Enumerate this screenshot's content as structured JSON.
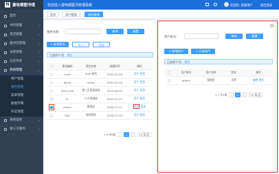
{
  "app": {
    "title": "曼哈顿图书馆",
    "logo_letter": "N"
  },
  "header": {
    "title": "欢迎进入曼哈顿图书管理系统",
    "user": "欢迎您, 超级用户",
    "logout": "退出登录"
  },
  "sidebar": {
    "items": [
      {
        "label": "首页"
      },
      {
        "label": "书刊管理",
        "arrow": "›"
      },
      {
        "label": "借还管理",
        "arrow": "›"
      },
      {
        "label": "图书馆管理",
        "arrow": "›"
      },
      {
        "label": "读者管理",
        "arrow": "›"
      },
      {
        "label": "信息共享",
        "arrow": "›"
      },
      {
        "label": "系统管理",
        "arrow": "⌄"
      }
    ],
    "sub_items": [
      {
        "label": "用户管理"
      },
      {
        "label": "角色管理"
      },
      {
        "label": "菜单管理"
      },
      {
        "label": "数据字典"
      },
      {
        "label": "日志管理"
      }
    ],
    "bottom_items": [
      {
        "label": "系统监控",
        "arrow": "›"
      },
      {
        "label": "第三方服务",
        "arrow": "›"
      }
    ]
  },
  "tabs": [
    {
      "label": "首页"
    },
    {
      "label": "用户管理"
    },
    {
      "label": "角色管理"
    }
  ],
  "role_panel": {
    "search_label": "角色名称:",
    "search_button": "查询",
    "reset_button": "重置",
    "add_button": "+ 新增角色",
    "import_button": "导入",
    "export_button": "导出",
    "selected_text": "已选择 0 项",
    "clear_link": "清空",
    "columns": [
      "角色编码",
      "角色名称",
      "创建时间",
      "操作"
    ],
    "rows": [
      {
        "code": "vue3",
        "name": "Vue3角色",
        "date": "2022-02-09",
        "edit": "用户",
        "more": "更多"
      },
      {
        "code": "demo",
        "name": "demo",
        "date": "2020-05-14",
        "edit": "用户",
        "more": "更多"
      },
      {
        "code": "third_role",
        "name": "第三方登录角色",
        "date": "2019-06-20",
        "edit": "用户",
        "more": "更多"
      },
      {
        "code": "hr",
        "name": "人力资源部",
        "date": "2019-01-21",
        "edit": "用户",
        "more": "更多"
      },
      {
        "code": "admin",
        "name": "管理员",
        "date": "2018-12-21",
        "edit": "用户",
        "more": "更多"
      },
      {
        "code": "test",
        "name": "临时角色",
        "date": "2018-12-20",
        "edit": "用户",
        "more": "更多"
      }
    ],
    "pager": {
      "range": "1-6 共6条",
      "prev": "‹",
      "page": "1",
      "next": "›",
      "page_size": "10 条/页"
    }
  },
  "user_panel": {
    "search_label": "用户账号:",
    "search_button": "查询",
    "reset_button": "重置",
    "add_button": "+ 新增用户",
    "link_button": "+ 已有用户",
    "selected_text": "已选择 0 项",
    "clear_link": "清空",
    "columns": [
      "用户账号",
      "用户名称",
      "状态",
      "操作"
    ],
    "rows": [
      {
        "account": "admin",
        "name": "管理员",
        "status": "正常",
        "edit": "编辑",
        "more": "更多"
      }
    ],
    "pager": {
      "range": "1-1 共1条",
      "prev": "‹",
      "page": "1",
      "next": "›",
      "page_size": "10 条/页"
    }
  }
}
